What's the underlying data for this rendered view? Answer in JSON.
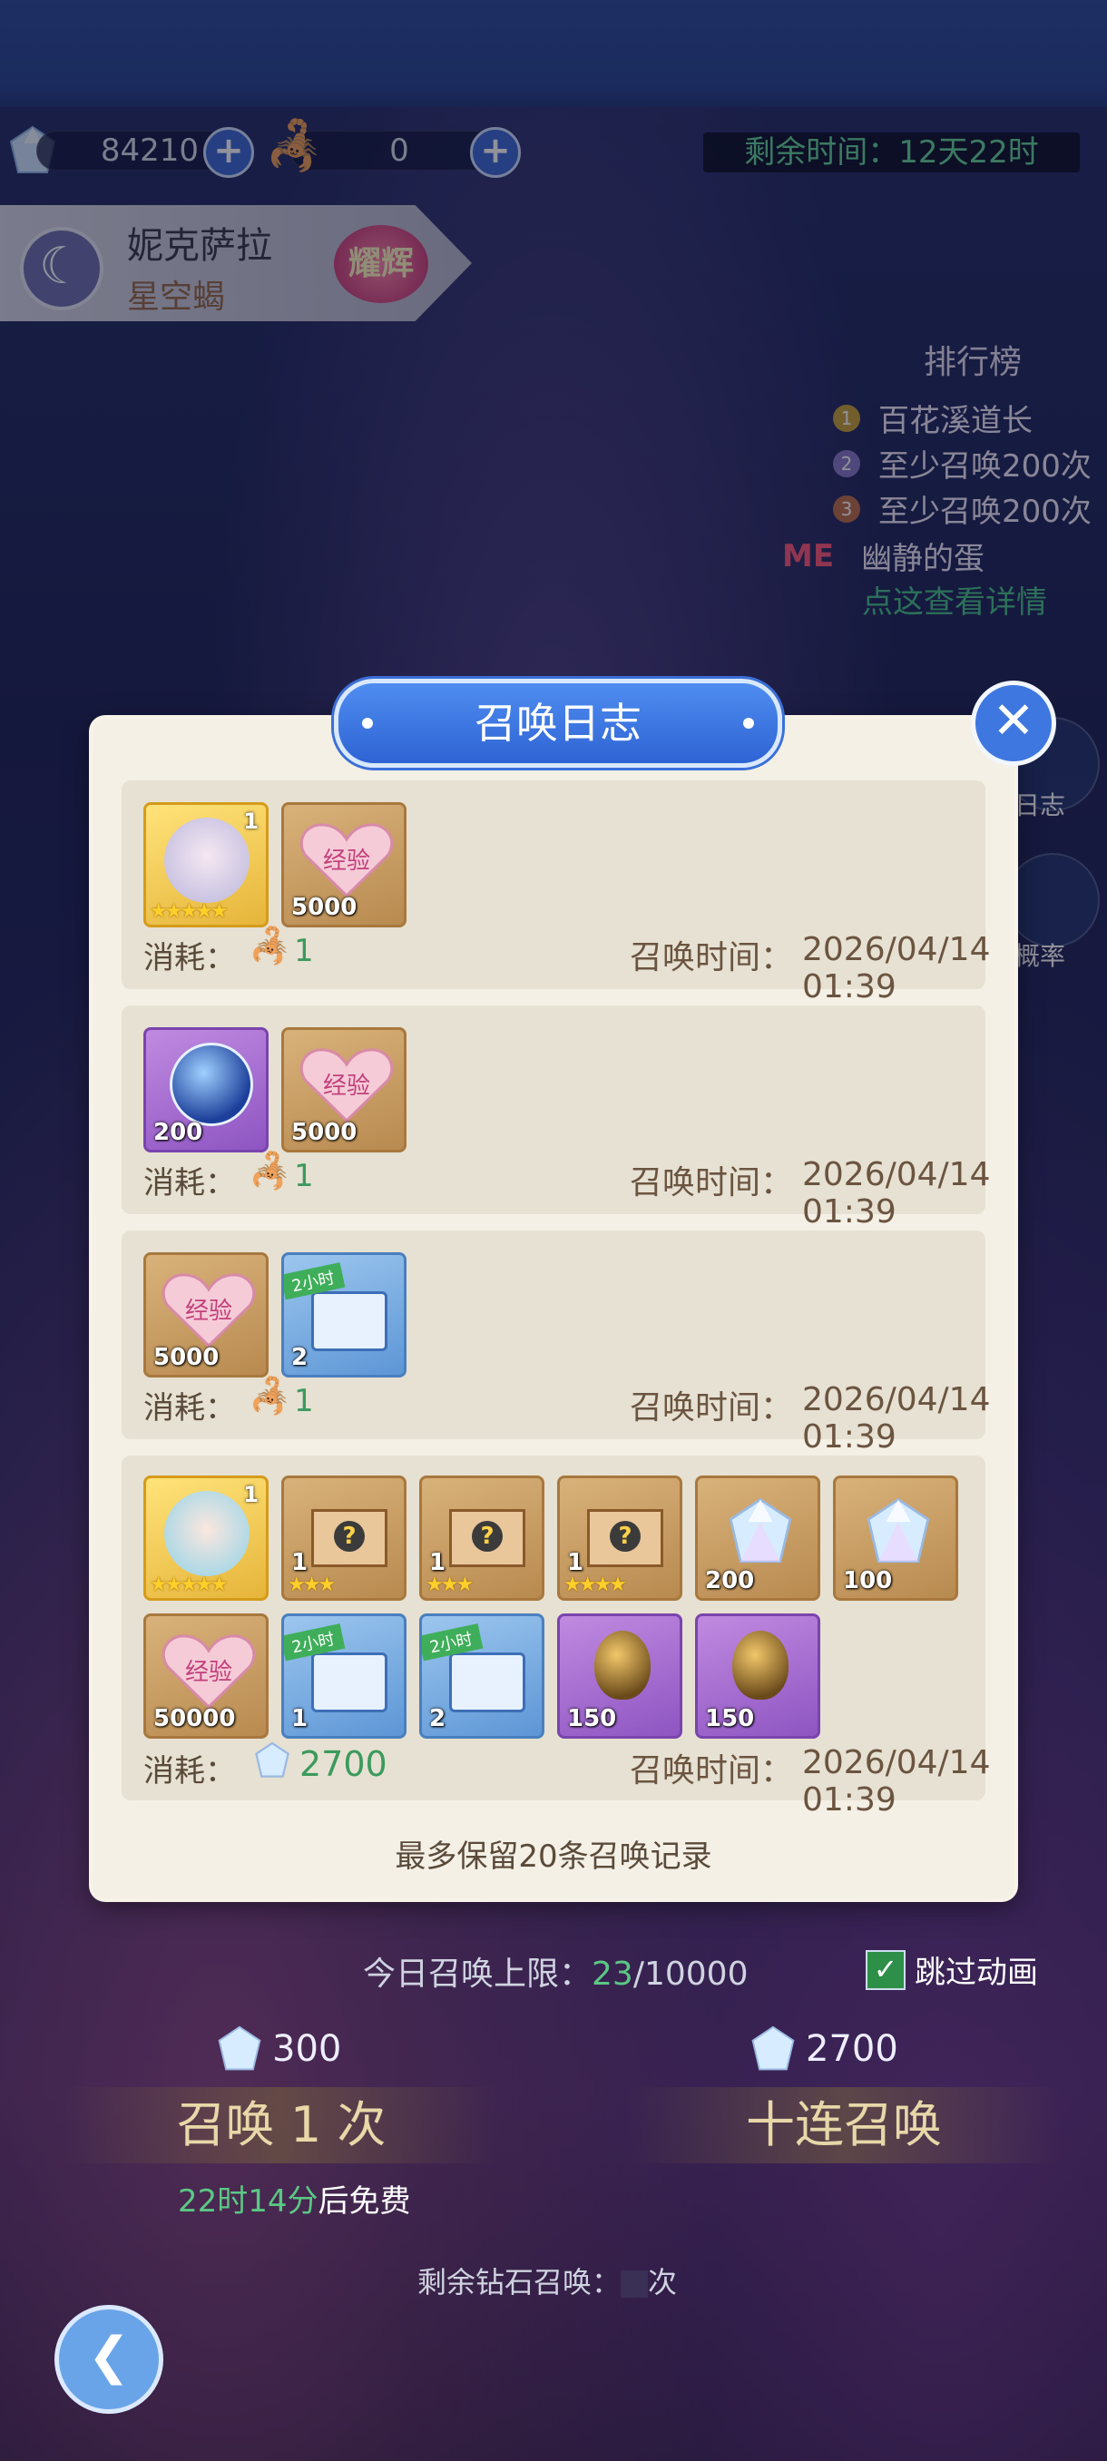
{
  "hud": {
    "diamonds": "84210",
    "scorpion_currency": "0",
    "timer": "剩余时间：12天22时"
  },
  "hero": {
    "name": "妮克萨拉",
    "subtitle": "星空蝎",
    "badge": "耀辉"
  },
  "ranking": {
    "title": "排行榜",
    "rows": [
      {
        "rank": "1",
        "text": "百花溪道长"
      },
      {
        "rank": "2",
        "text": "至少召唤200次"
      },
      {
        "rank": "3",
        "text": "至少召唤200次"
      },
      {
        "rank": "ME",
        "text": "幽静的蛋"
      }
    ],
    "detail_link": "点这查看详情"
  },
  "side": {
    "log_label": "日志",
    "rate_label": "概率"
  },
  "dialog": {
    "title": "召唤日志",
    "cost_label": "消耗：",
    "time_label": "召唤时间：",
    "footer": "最多保留20条召唤记录",
    "records": [
      {
        "items": [
          {
            "type": "hero",
            "qty": "",
            "level": "1",
            "stars": "★★★★★"
          },
          {
            "type": "exp",
            "qty": "5000",
            "label": "经验"
          }
        ],
        "cost": "1",
        "cost_icon": "scorpion-icon",
        "time": "2026/04/14 01:39"
      },
      {
        "items": [
          {
            "type": "star-orb",
            "qty": "200"
          },
          {
            "type": "exp",
            "qty": "5000",
            "label": "经验"
          }
        ],
        "cost": "1",
        "cost_icon": "scorpion-icon",
        "time": "2026/04/14 01:39"
      },
      {
        "items": [
          {
            "type": "exp",
            "qty": "5000",
            "label": "经验"
          },
          {
            "type": "chest",
            "qty": "2",
            "tag": "2小时"
          }
        ],
        "cost": "1",
        "cost_icon": "scorpion-icon",
        "time": "2026/04/14 01:39"
      },
      {
        "items": [
          {
            "type": "hero",
            "qty": "",
            "level": "1",
            "stars": "★★★★★"
          },
          {
            "type": "mystery-box",
            "qty": "1",
            "stars": "★★★"
          },
          {
            "type": "mystery-box",
            "qty": "1",
            "stars": "★★★"
          },
          {
            "type": "mystery-box",
            "qty": "1",
            "stars": "★★★★"
          },
          {
            "type": "diamond",
            "qty": "200"
          },
          {
            "type": "diamond",
            "qty": "100"
          },
          {
            "type": "exp",
            "qty": "50000",
            "label": "经验"
          },
          {
            "type": "chest",
            "qty": "1",
            "tag": "2小时"
          },
          {
            "type": "chest",
            "qty": "2",
            "tag": "2小时"
          },
          {
            "type": "egg",
            "qty": "150"
          },
          {
            "type": "egg",
            "qty": "150"
          }
        ],
        "cost": "2700",
        "cost_icon": "diamond-icon",
        "time": "2026/04/14 01:39"
      }
    ]
  },
  "bottom": {
    "limit_label": "今日召唤上限：",
    "limit_used": "23",
    "limit_total": "/10000",
    "skip_label": "跳过动画",
    "price_single": "300",
    "price_ten": "2700",
    "summon_once": "召唤 1 次",
    "summon_ten": "十连召唤",
    "free_time": "22时14分",
    "free_suffix": "后免费",
    "remain_label": "剩余钻石召唤：",
    "remain_suffix": "次"
  },
  "colors": {
    "dialog_bg": "#f4f0e6",
    "record_bg": "#e6e1d2",
    "accent_blue": "#3f77e0",
    "cost_green": "#3c9a5c"
  }
}
